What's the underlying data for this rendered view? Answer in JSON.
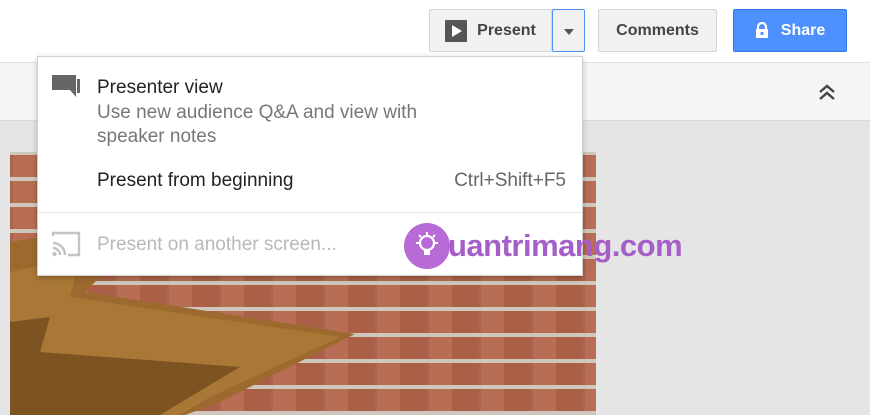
{
  "topbar": {
    "present_label": "Present",
    "comments_label": "Comments",
    "share_label": "Share"
  },
  "present_menu": {
    "items": [
      {
        "label": "Presenter view",
        "description": "Use new audience Q&A and view with speaker notes",
        "icon": "presenter-view-icon"
      },
      {
        "label": "Present from beginning",
        "shortcut": "Ctrl+Shift+F5"
      },
      {
        "label": "Present on another screen...",
        "icon": "cast-icon",
        "disabled": true
      }
    ]
  },
  "watermark": {
    "text": "uantrimang.com"
  },
  "colors": {
    "accent": "#4d90fe",
    "watermark": "#a65fc8",
    "brick": "#b4644a",
    "star": "#9c6a2e"
  }
}
